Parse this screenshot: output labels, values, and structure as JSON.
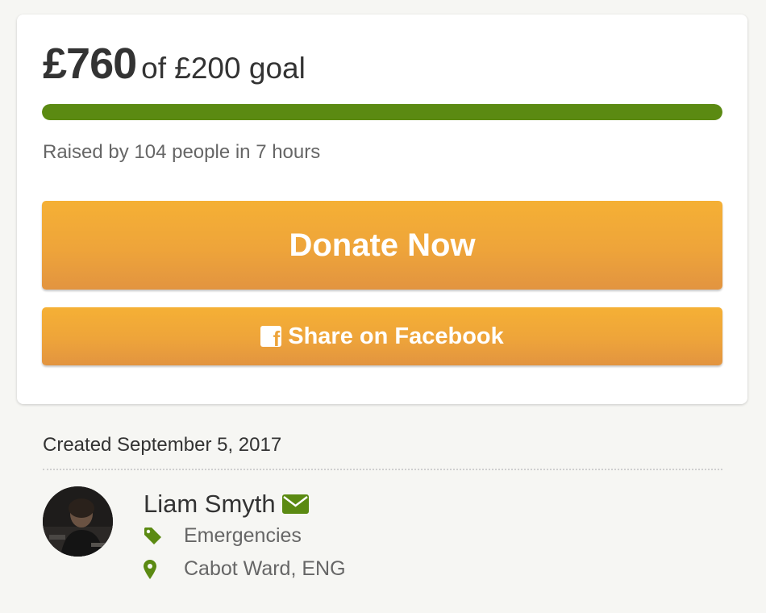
{
  "fundraiser": {
    "raised": "£760",
    "goal_text": "of £200 goal",
    "progress_fraction": 1.0,
    "raised_by": "Raised by 104 people in 7 hours"
  },
  "actions": {
    "donate_label": "Donate Now",
    "share_label": "Share on Facebook"
  },
  "details": {
    "created": "Created September 5, 2017",
    "organizer_name": "Liam Smyth",
    "category": "Emergencies",
    "location": "Cabot Ward, ENG"
  },
  "colors": {
    "accent_green": "#5b8a12",
    "button_orange": "#eea43a",
    "text_dark": "#333333",
    "text_muted": "#666666",
    "background": "#f6f6f3"
  },
  "icons": {
    "facebook": "facebook-icon",
    "mail": "envelope-icon",
    "category": "tag-icon",
    "location": "map-pin-icon"
  }
}
